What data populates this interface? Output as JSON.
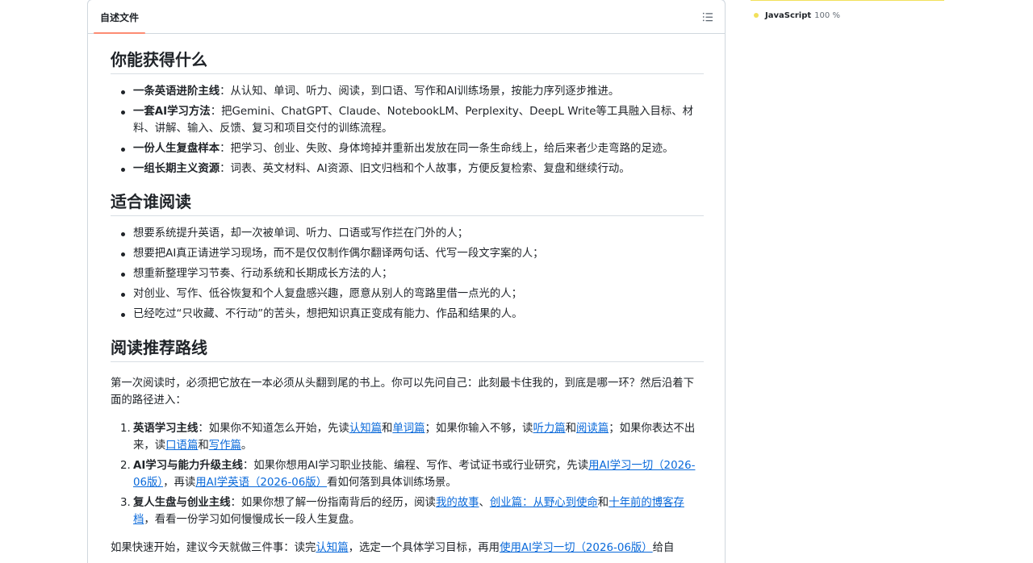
{
  "readme_tab": "自述文件",
  "outline_icon": "list-unordered-icon",
  "colors": {
    "accent_tab": "#fd8c73",
    "link": "#0969da",
    "javascript": "#f1e05a"
  },
  "language": {
    "name": "JavaScript",
    "percent": "100 %",
    "percent_value": 100
  },
  "sections": {
    "gain": {
      "heading": "你能获得什么",
      "items": [
        {
          "bold": "一条英语进阶主线",
          "text": "：从认知、单词、听力、阅读，到口语、写作和AI训练场景，按能力序列逐步推进。"
        },
        {
          "bold": "一套AI学习方法",
          "text": "：把Gemini、ChatGPT、Claude、NotebookLM、Perplexity、DeepL Write等工具融入目标、材料、讲解、输入、反馈、复习和项目交付的训练流程。"
        },
        {
          "bold": "一份人生复盘样本",
          "text": "：把学习、创业、失败、身体垮掉并重新出发放在同一条生命线上，给后来者少走弯路的足迹。"
        },
        {
          "bold": "一组长期主义资源",
          "text": "：词表、英文材料、AI资源、旧文归档和个人故事，方便反复检索、复盘和继续行动。"
        }
      ]
    },
    "audience": {
      "heading": "适合谁阅读",
      "items": [
        "想要系统提升英语，却一次被单词、听力、口语或写作拦在门外的人；",
        "想要把AI真正请进学习现场，而不是仅仅制作偶尔翻译两句话、代写一段文字案的人；",
        "想重新整理学习节奏、行动系统和长期成长方法的人；",
        "对创业、写作、低谷恢复和个人复盘感兴趣，愿意从别人的弯路里借一点光的人；",
        "已经吃过“只收藏、不行动”的苦头，想把知识真正变成有能力、作品和结果的人。"
      ]
    },
    "path": {
      "heading": "阅读推荐路线",
      "intro": "第一次阅读时，必须把它放在一本必须从头翻到尾的书上。你可以先问自己：此刻最卡住我的，到底是哪一环？然后沿着下面的路径进入：",
      "routes": [
        {
          "num": "1.",
          "bold": "英语学习主线",
          "t1": "：如果你不知道怎么开始，先读",
          "l1": "认知篇",
          "t2": "和",
          "l2": "单词篇",
          "t3": "；如果你输入不够，读",
          "l3": "听力篇",
          "t4": "和",
          "l4": "阅读篇",
          "t5": "；如果你表达不出来，读",
          "l5": "口语篇",
          "t6": "和",
          "l6": "写作篇",
          "t7": "。"
        },
        {
          "num": "2.",
          "bold": "AI学习与能力升级主线",
          "t1": "：如果你想用AI学习职业技能、编程、写作、考试证书或行业研究，先读",
          "l1": "用AI学习一切（2026-06版）",
          "t2": "，再读",
          "l2": "用AI学英语（2026-06版）",
          "t3": "看如何落到具体训练场景。"
        },
        {
          "num": "3.",
          "bold": "复人生盘与创业主线",
          "t1": "：如果你想了解一份指南背后的经历，阅读",
          "l1": "我的故事",
          "t2": "、",
          "l2": "创业篇：从野心到使命",
          "t3": "和",
          "l3": "十年前的博客存档",
          "t4": "，看看一份学习如何慢慢成长一段人生复盘。"
        }
      ],
      "closing": {
        "t1": "如果快速开始，建议今天就做三件事：读完",
        "l1": "认知篇",
        "t2": "，选定一个具体学习目标，再用",
        "l2": "使用AI学习一切（2026-06版）",
        "t3": "给自"
      }
    }
  }
}
